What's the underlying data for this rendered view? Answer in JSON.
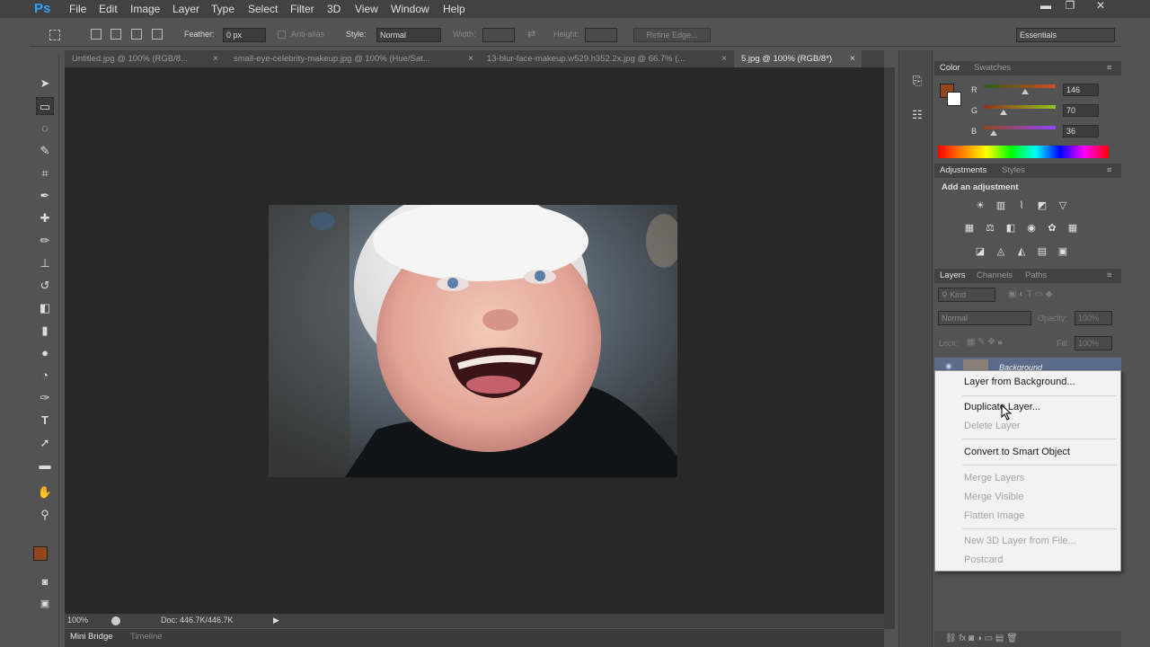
{
  "app": {
    "logo": "Ps"
  },
  "menubar": {
    "items": [
      "File",
      "Edit",
      "Image",
      "Layer",
      "Type",
      "Select",
      "Filter",
      "3D",
      "View",
      "Window",
      "Help"
    ]
  },
  "window_controls": {
    "minimize": "▬",
    "restore": "❐",
    "close": "✕"
  },
  "options_bar": {
    "feather_label": "Feather:",
    "feather_value": "0 px",
    "antialias_label": "Anti-alias",
    "style_label": "Style:",
    "style_value": "Normal",
    "width_label": "Width:",
    "height_label": "Height:",
    "refine_edge": "Refine Edge...",
    "workspace": "Essentials"
  },
  "doc_tabs": [
    {
      "label": "Untitled.jpg @ 100% (RGB/8..."
    },
    {
      "label": "small-eye-celebrity-makeup.jpg @ 100% (Hue/Sat..."
    },
    {
      "label": "13-blur-face-makeup.w529.h352.2x.jpg @ 66.7% (..."
    },
    {
      "label": "5.jpg @ 100% (RGB/8*)"
    }
  ],
  "status_bar": {
    "zoom": "100%",
    "doc": "Doc: 446.7K/446.7K"
  },
  "bottom_tabs": {
    "mini_bridge": "Mini Bridge",
    "timeline": "Timeline"
  },
  "colors": {
    "foreground": "#92461e",
    "background": "#ffffff",
    "accent": "#2aa3ff"
  },
  "color_panel": {
    "tabs": [
      "Color",
      "Swatches"
    ],
    "channels": [
      {
        "label": "R",
        "value": "146",
        "fraction": 0.57
      },
      {
        "label": "G",
        "value": "70",
        "fraction": 0.27
      },
      {
        "label": "B",
        "value": "36",
        "fraction": 0.14
      }
    ]
  },
  "adjustments_panel": {
    "tabs": [
      "Adjustments",
      "Styles"
    ],
    "heading": "Add an adjustment"
  },
  "layers_panel": {
    "tabs": [
      "Layers",
      "Channels",
      "Paths"
    ],
    "kind": "Kind",
    "blend_mode": "Normal",
    "opacity_label": "Opacity:",
    "opacity_value": "100%",
    "lock_label": "Lock:",
    "fill_label": "Fill:",
    "fill_value": "100%",
    "layer_name": "Background"
  },
  "context_menu": {
    "items": [
      {
        "label": "Layer from Background...",
        "enabled": true
      },
      {
        "label": "Duplicate Layer...",
        "enabled": true
      },
      {
        "label": "Delete Layer",
        "enabled": false
      },
      {
        "label": "Convert to Smart Object",
        "enabled": true
      },
      {
        "label": "Merge Layers",
        "enabled": false
      },
      {
        "label": "Merge Visible",
        "enabled": false
      },
      {
        "label": "Flatten Image",
        "enabled": false
      },
      {
        "label": "New 3D Layer from File...",
        "enabled": false
      },
      {
        "label": "Postcard",
        "enabled": false
      }
    ]
  }
}
